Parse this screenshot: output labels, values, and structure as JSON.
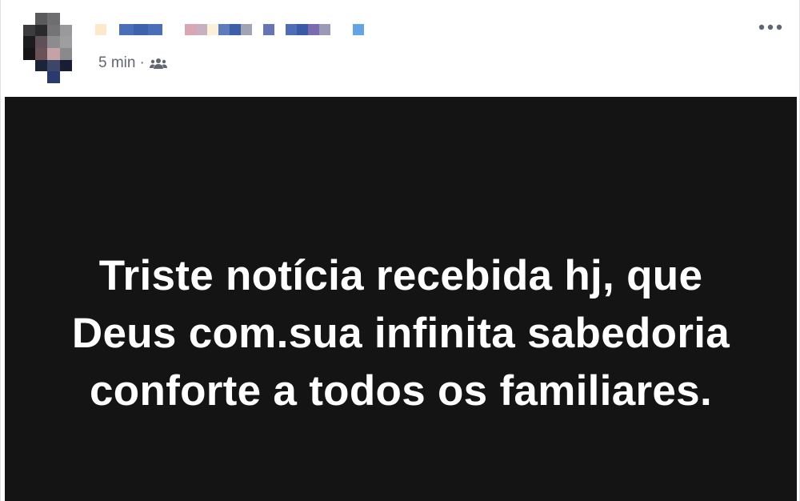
{
  "post": {
    "author": {
      "name_redacted": true,
      "avatar_redacted": true
    },
    "timestamp": "5 min",
    "separator": "·",
    "audience_icon": "friends-icon",
    "more_icon": "more-options-icon",
    "body_text": "Triste notícia recebida hj, que Deus com.sua infinita sabedoria conforte a todos os familiares.",
    "colors": {
      "card_background": "#141414",
      "card_text": "#ffffff",
      "meta_text": "#616770"
    }
  }
}
